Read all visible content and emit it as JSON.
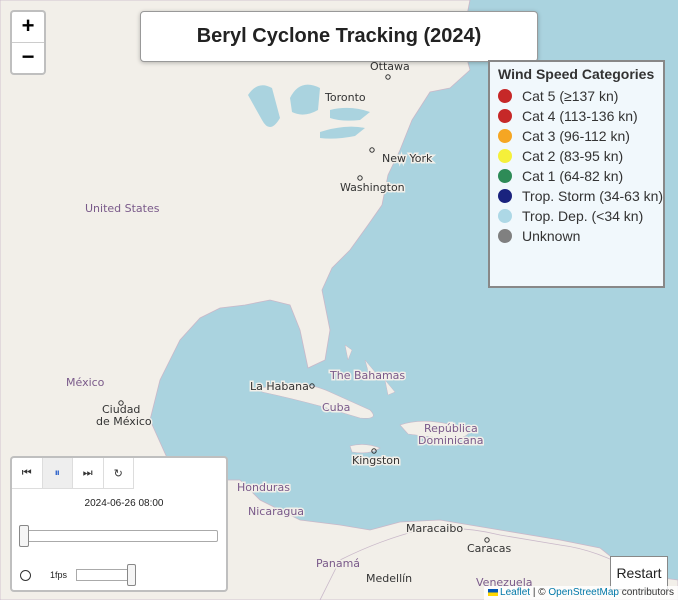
{
  "title": "Beryl Cyclone Tracking (2024)",
  "zoom": {
    "in_label": "+",
    "out_label": "−"
  },
  "map_labels": {
    "ottawa": "Ottawa",
    "toronto": "Toronto",
    "new_york": "New York",
    "washington": "Washington",
    "united_states": "United States",
    "mexico": "México",
    "ciudad": "Ciudad",
    "de_mexico": "de México",
    "la_habana": "La Habana",
    "bahamas": "The Bahamas",
    "cuba": "Cuba",
    "republica": "República",
    "dominicana": "Dominicana",
    "kingston": "Kingston",
    "honduras": "Honduras",
    "nicaragua": "Nicaragua",
    "maracaibo": "Maracaibo",
    "caracas": "Caracas",
    "panama": "Panamá",
    "medellin": "Medellín",
    "venezuela": "Venezuela"
  },
  "legend": {
    "title": "Wind Speed Categories",
    "items": [
      {
        "label": "Cat 5 (≥137 kn)",
        "color": "#c62828"
      },
      {
        "label": "Cat 4 (113-136 kn)",
        "color": "#c62828"
      },
      {
        "label": "Cat 3 (96-112 kn)",
        "color": "#f5a623"
      },
      {
        "label": "Cat 2 (83-95 kn)",
        "color": "#f5f03a"
      },
      {
        "label": "Cat 1 (64-82 kn)",
        "color": "#2e8b57"
      },
      {
        "label": "Trop. Storm (34-63 kn)",
        "color": "#1a237e"
      },
      {
        "label": "Trop. Dep. (<34 kn)",
        "color": "#add8e6"
      },
      {
        "label": "Unknown",
        "color": "#808080"
      }
    ]
  },
  "player": {
    "timestamp": "2024-06-26 08:00",
    "fps_label": "1fps",
    "buttons": [
      "⏮",
      "⏸",
      "⏭",
      "↻"
    ]
  },
  "restart_label": "Restart",
  "attribution": {
    "leaflet": "Leaflet",
    "sep": "| ©",
    "osm": "OpenStreetMap",
    "contributors": "contributors"
  }
}
